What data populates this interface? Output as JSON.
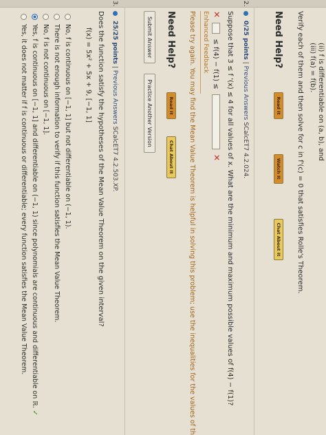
{
  "q1": {
    "cond2": "(ii)  f is differentiable on  (a, b), and",
    "cond3": "(iii)  f(a) = f(b).",
    "verify": "Verify each of them and then solve for c in  f'(c) = 0  that satisfies Rolle's Theorem.",
    "need_help": "Need Help?",
    "btn_read": "Read It",
    "btn_watch": "Watch It",
    "btn_chat": "Chat About It"
  },
  "q2": {
    "number": "2.",
    "points": "0/25 points",
    "previous": "Previous Answers",
    "ref": "SCalcET7 4.2.024.",
    "prompt": "Suppose that 3 ≤ f '(x) ≤ 4 for all values of x. What are the minimum and maximum possible values of  f(4) − f(1)?",
    "ineq": "≤ f(4) − f(1) ≤",
    "feedback_title": "Enhanced Feedback",
    "feedback_text": "Please try again. You may find the Mean Value Theorem is helpful in solving this problem; use the inequalities for the values of the de",
    "need_help": "Need Help?",
    "btn_read": "Read It",
    "btn_chat": "Chat About It",
    "submit": "Submit Answer",
    "practice": "Practice Another Version"
  },
  "q3": {
    "number": "3.",
    "points": "25/25 points",
    "previous": "Previous Answers",
    "ref": "SCalcET7 4.2.503.XP.",
    "prompt": "Does the function satisfy the hypotheses of the Mean Value Theorem on the given interval?",
    "function": "f(x) = 5x² + 5x + 9,   [−1, 1]",
    "options": [
      "No, f is continuous on [−1, 1] but not differentiable on (−1, 1).",
      "There is not enough information to verify if this function satisfies the Mean Value Theorem.",
      "No, f is not continuous on [−1, 1].",
      "Yes, f is continuous on [−1, 1] and differentiable on (−1, 1) since polynomials are continuous and differentiable on ℝ.",
      "Yes, it does not matter if f is continuous or differentiable; every function satisfies the Mean Value Theorem."
    ],
    "check": "✓"
  },
  "colors": {
    "accent": "#2e6fb6",
    "wrong": "#c42a2a",
    "feedback": "#b8711d"
  }
}
